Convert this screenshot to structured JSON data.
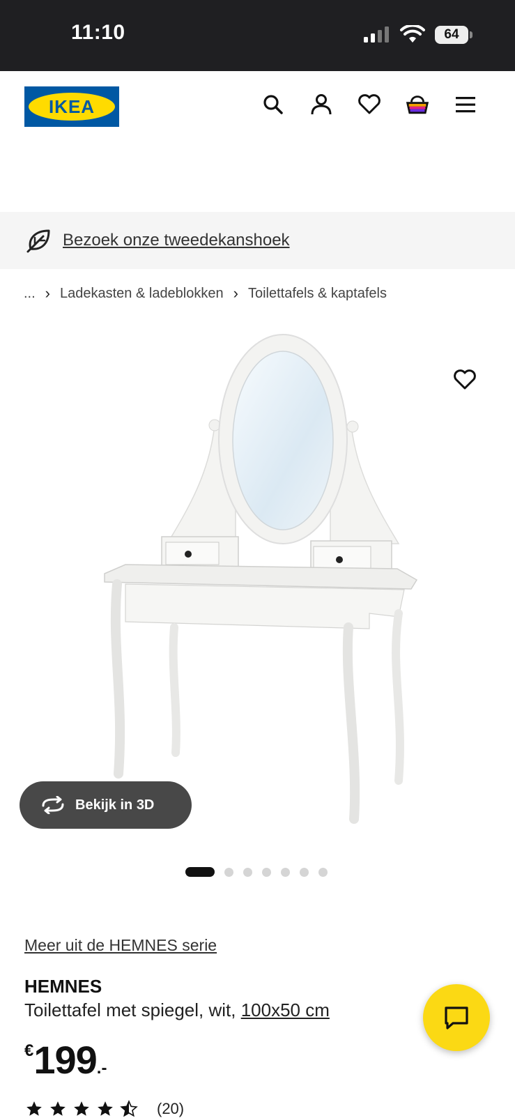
{
  "status_bar": {
    "time": "11:10",
    "battery": "64"
  },
  "header": {
    "logo_text": "IKEA",
    "icons": [
      "search-icon",
      "account-icon",
      "heart-icon",
      "basket-icon",
      "menu-icon"
    ]
  },
  "promo": {
    "link": "Bezoek onze tweedekanshoek",
    "icon": "leaf-icon"
  },
  "breadcrumb": {
    "ellipsis": "...",
    "items": [
      "Ladekasten & ladeblokken",
      "Toilettafels & kaptafels"
    ]
  },
  "gallery": {
    "view_3d_label": "Bekijk in 3D",
    "dot_count": 7,
    "active_index": 0
  },
  "product": {
    "series_link": "Meer uit de HEMNES serie",
    "name": "HEMNES",
    "description": "Toilettafel met spiegel, wit, ",
    "dimensions": "100x50 cm",
    "currency": "€",
    "price_int": "199",
    "price_dec": ".-",
    "rating_value": 4.5,
    "review_count": "(20)"
  },
  "colors": {
    "ikea_blue": "#0058a3",
    "ikea_yellow": "#ffdb00",
    "chat_yellow": "#fbd914"
  }
}
